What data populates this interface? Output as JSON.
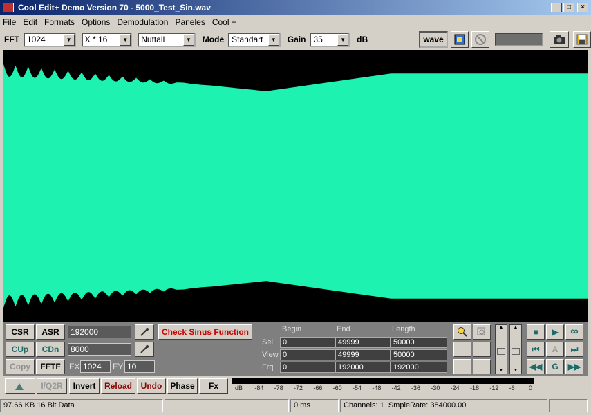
{
  "window": {
    "title": "Cool Edit+ Demo Version 70 - 5000_Test_Sin.wav",
    "minimize": "_",
    "maximize": "□",
    "close": "×"
  },
  "menu": [
    "File",
    "Edit",
    "Formats",
    "Options",
    "Demodulation",
    "Paneles",
    "Cool +"
  ],
  "toolbar": {
    "fft_label": "FFT",
    "fft_value": "1024",
    "zoom_value": "X * 16",
    "window_value": "Nuttall",
    "mode_label": "Mode",
    "mode_value": "Standart",
    "gain_label": "Gain",
    "gain_value": "35",
    "gain_unit": "dB",
    "wave_button": "wave"
  },
  "buttons": {
    "csr": "CSR",
    "asr": "ASR",
    "cup": "CUp",
    "cdn": "CDn",
    "copy": "Copy",
    "fftf": "FFTF",
    "check_sinus": "Check Sinus Function",
    "iq2r": "I/Q2R",
    "invert": "Invert",
    "reload": "Reload",
    "undo": "Undo",
    "phase": "Phase",
    "fx": "Fx"
  },
  "inputs": {
    "asr_value": "192000",
    "cdn_value": "8000",
    "fx_label": "FX",
    "fx_value": "1024",
    "fy_label": "FY",
    "fy_value": "10"
  },
  "table": {
    "headers": [
      "Begin",
      "End",
      "Length"
    ],
    "rows": [
      {
        "label": "Sel",
        "values": [
          "0",
          "49999",
          "50000"
        ]
      },
      {
        "label": "View",
        "values": [
          "0",
          "49999",
          "50000"
        ]
      },
      {
        "label": "Frq",
        "values": [
          "0",
          "192000",
          "192000"
        ]
      }
    ]
  },
  "nav": {
    "btn_a": "A",
    "btn_g": "G"
  },
  "meter": {
    "ticks": [
      "dB",
      "-84",
      "-78",
      "-72",
      "-66",
      "-60",
      "-54",
      "-48",
      "-42",
      "-36",
      "-30",
      "-24",
      "-18",
      "-12",
      "-6",
      "0"
    ]
  },
  "status": {
    "size": "97.66 KB 16 Bit Data",
    "time": "0 ms",
    "channels": "Channels: 1",
    "samplerate": "SmpleRate: 384000.00"
  },
  "colors": {
    "waveform": "#1df2b0",
    "title_start": "#0a246a",
    "reload": "#8b0000",
    "check_sinus": "#cc0000"
  }
}
